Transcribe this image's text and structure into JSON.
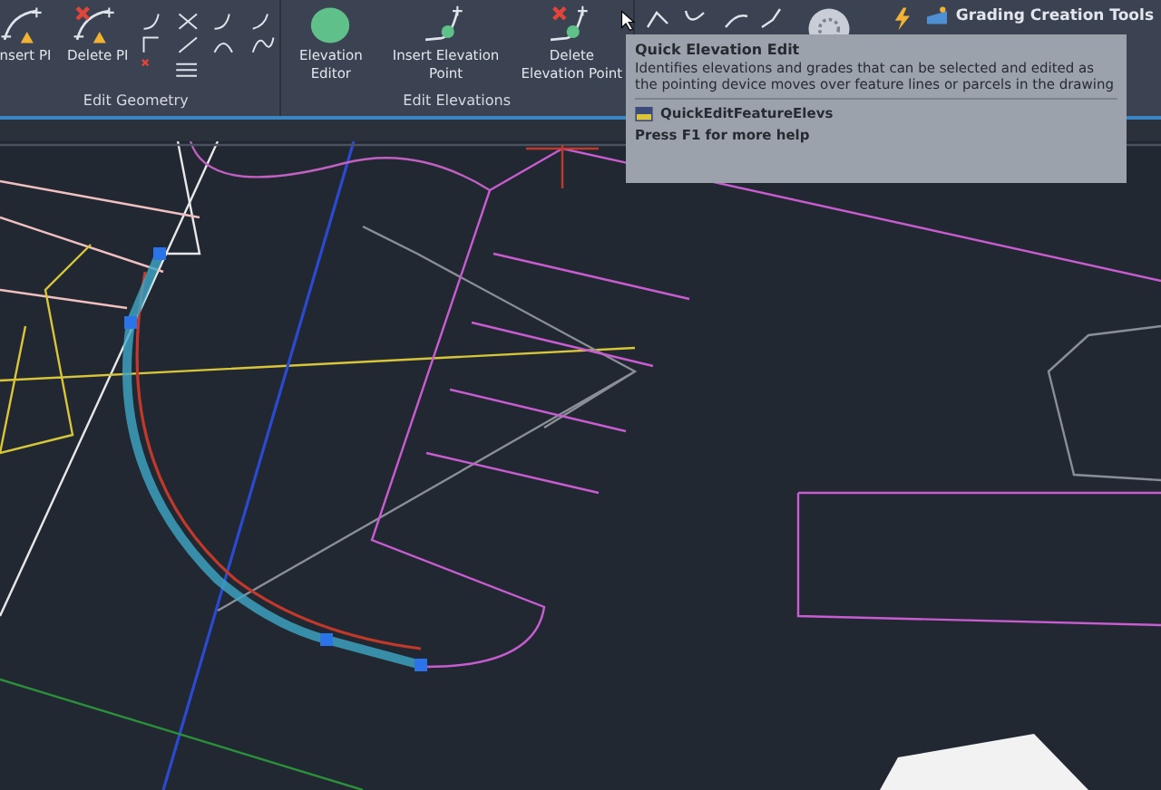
{
  "ribbon": {
    "panels": [
      {
        "title": "Edit Geometry",
        "tools": [
          {
            "label": "nsert PI",
            "kind": "insert"
          },
          {
            "label": "Delete PI",
            "kind": "delete"
          }
        ]
      },
      {
        "title": "Edit Elevations",
        "tools": [
          {
            "label": "Elevation Editor",
            "kind": "editor"
          },
          {
            "label": "Insert Elevation Point",
            "kind": "insert"
          },
          {
            "label": "Delete Elevation Point",
            "kind": "delete"
          }
        ]
      }
    ],
    "grading_tools": {
      "label": "Grading Creation Tools"
    }
  },
  "tooltip": {
    "title": "Quick Elevation Edit",
    "description": "Identifies elevations and grades that can be selected and edited as the pointing device moves over feature lines or parcels in the drawing",
    "command": "QuickEditFeatureElevs",
    "help": "Press F1 for more help"
  }
}
